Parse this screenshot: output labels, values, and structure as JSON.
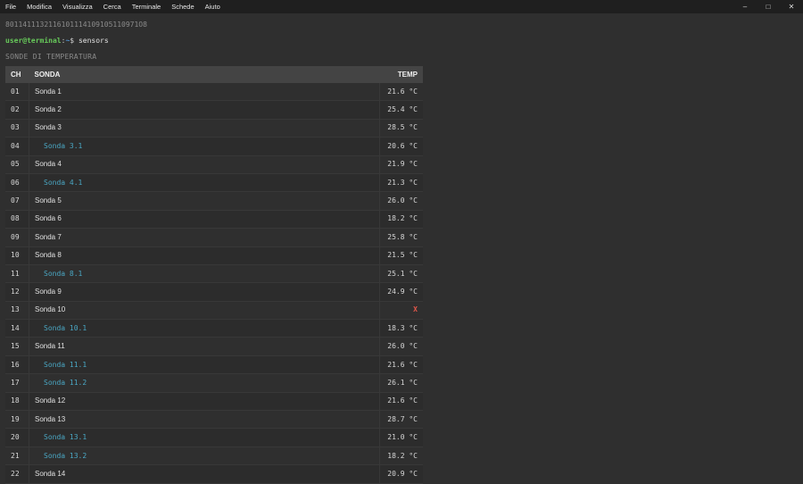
{
  "menu": [
    "File",
    "Modifica",
    "Visualizza",
    "Cerca",
    "Terminale",
    "Schede",
    "Aiuto"
  ],
  "window_controls": {
    "minimize": "–",
    "maximize": "□",
    "close": "✕"
  },
  "terminal": {
    "id_line": "8011411132116101114109105110971O8",
    "prompt": {
      "user": "user@terminal",
      "sep": ":",
      "path": "~",
      "symbol": "$",
      "command": "sensors"
    },
    "section_title": "SONDE DI TEMPERATURA"
  },
  "table": {
    "headers": {
      "ch": "CH",
      "name": "SONDA",
      "temp": "TEMP"
    },
    "rows": [
      {
        "ch": "01",
        "name": "Sonda 1",
        "temp": "21.6 °C",
        "sub": false
      },
      {
        "ch": "02",
        "name": "Sonda 2",
        "temp": "25.4 °C",
        "sub": false
      },
      {
        "ch": "03",
        "name": "Sonda 3",
        "temp": "28.5 °C",
        "sub": false
      },
      {
        "ch": "04",
        "name": "Sonda 3.1",
        "temp": "20.6 °C",
        "sub": true
      },
      {
        "ch": "05",
        "name": "Sonda 4",
        "temp": "21.9 °C",
        "sub": false
      },
      {
        "ch": "06",
        "name": "Sonda 4.1",
        "temp": "21.3 °C",
        "sub": true
      },
      {
        "ch": "07",
        "name": "Sonda 5",
        "temp": "26.0 °C",
        "sub": false
      },
      {
        "ch": "08",
        "name": "Sonda 6",
        "temp": "18.2 °C",
        "sub": false
      },
      {
        "ch": "09",
        "name": "Sonda 7",
        "temp": "25.8 °C",
        "sub": false
      },
      {
        "ch": "10",
        "name": "Sonda 8",
        "temp": "21.5 °C",
        "sub": false
      },
      {
        "ch": "11",
        "name": "Sonda 8.1",
        "temp": "25.1 °C",
        "sub": true
      },
      {
        "ch": "12",
        "name": "Sonda 9",
        "temp": "24.9 °C",
        "sub": false
      },
      {
        "ch": "13",
        "name": "Sonda 10",
        "temp": "X",
        "sub": false,
        "error": true
      },
      {
        "ch": "14",
        "name": "Sonda 10.1",
        "temp": "18.3 °C",
        "sub": true
      },
      {
        "ch": "15",
        "name": "Sonda 11",
        "temp": "26.0 °C",
        "sub": false
      },
      {
        "ch": "16",
        "name": "Sonda 11.1",
        "temp": "21.6 °C",
        "sub": true
      },
      {
        "ch": "17",
        "name": "Sonda 11.2",
        "temp": "26.1 °C",
        "sub": true
      },
      {
        "ch": "18",
        "name": "Sonda 12",
        "temp": "21.6 °C",
        "sub": false
      },
      {
        "ch": "19",
        "name": "Sonda 13",
        "temp": "28.7 °C",
        "sub": false
      },
      {
        "ch": "20",
        "name": "Sonda 13.1",
        "temp": "21.0 °C",
        "sub": true
      },
      {
        "ch": "21",
        "name": "Sonda 13.2",
        "temp": "18.2 °C",
        "sub": true
      },
      {
        "ch": "22",
        "name": "Sonda 14",
        "temp": "20.9 °C",
        "sub": false
      }
    ]
  },
  "colors": {
    "background": "#2f2f2f",
    "user": "#67c95a",
    "path": "#4f94d4",
    "sub_probe": "#4aa7c4",
    "error": "#e4574a"
  }
}
